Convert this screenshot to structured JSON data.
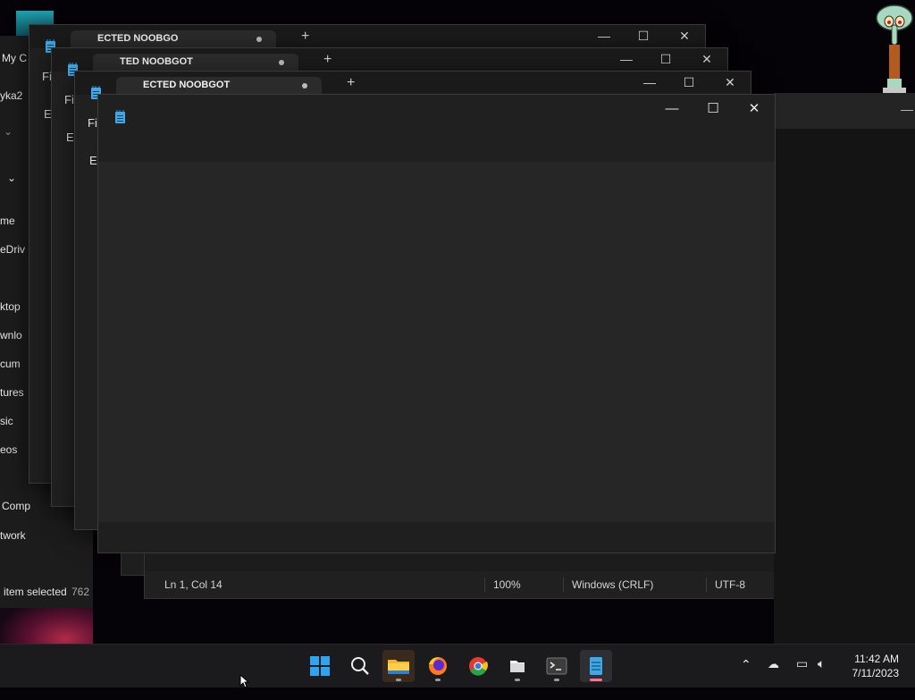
{
  "explorer": {
    "title_fragment": "My C",
    "user_fragment": "yka2",
    "nav_items": [
      "me",
      "eDriv",
      "ktop",
      "wnlo",
      "cum",
      "tures",
      "sic",
      "eos",
      "Comp",
      "twork"
    ],
    "status": "item selected",
    "status_size": "762"
  },
  "back_windows": [
    {
      "tab_title": "ECTED NOOBGO",
      "menu": [
        "Fi",
        "Ed"
      ]
    },
    {
      "tab_title": "TED NOOBGOT",
      "menu": [
        "Fil",
        "Ed"
      ]
    },
    {
      "tab_title": "ECTED NOOBGOT",
      "menu": [
        "Fil",
        "Ed"
      ]
    }
  ],
  "front_window": {
    "controls": {
      "minimize": "—",
      "maximize": "☐",
      "close": "✕"
    }
  },
  "status_window": {
    "position": "Ln 1, Col 14",
    "zoom": "100%",
    "line_ending": "Windows (CRLF)",
    "encoding": "UTF-8"
  },
  "taskbar": {
    "apps": [
      "start-icon",
      "search-icon",
      "file-explorer-icon",
      "firefox-icon",
      "chrome-icon",
      "files-icon",
      "terminal-icon",
      "notepad-icon"
    ],
    "active_app": "notepad-icon",
    "time": "11:42 AM",
    "date": "7/11/2023"
  },
  "colors": {
    "accent": "#ff6f8e",
    "notepad_blue": "#3fa9e8",
    "window_bg": "#202020"
  }
}
